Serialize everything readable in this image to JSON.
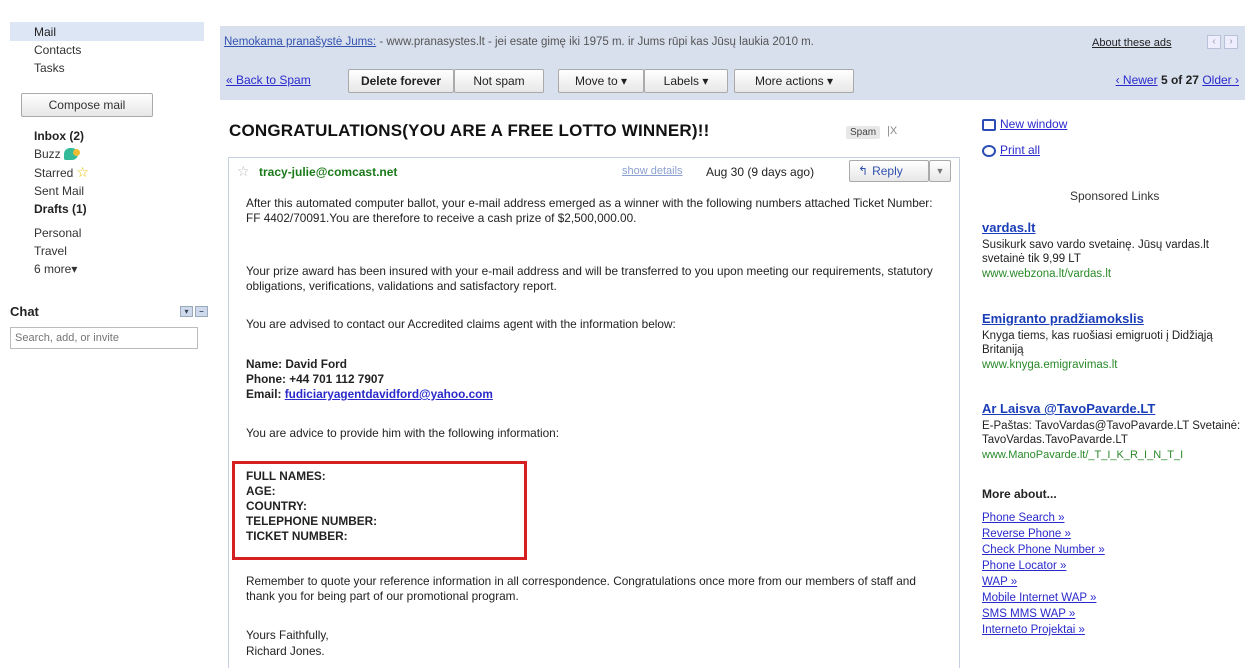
{
  "nav": {
    "mail": "Mail",
    "contacts": "Contacts",
    "tasks": "Tasks",
    "compose": "Compose mail",
    "inbox": "Inbox (2)",
    "buzz": "Buzz",
    "starred": "Starred",
    "sent": "Sent Mail",
    "drafts": "Drafts (1)",
    "personal": "Personal",
    "travel": "Travel",
    "more": "6 more▾"
  },
  "chat": {
    "title": "Chat",
    "search_placeholder": "Search, add, or invite"
  },
  "adbar": {
    "link": "Nemokama pranašystė Jums:",
    "text": " - www.pranasystes.lt - jei esate gimę iki 1975 m. ir Jums rūpi kas Jūsų laukia 2010 m.",
    "about": "About these ads"
  },
  "toolbar": {
    "back": "« Back to Spam",
    "delete_forever": "Delete forever",
    "not_spam": "Not spam",
    "move_to": "Move to ▾",
    "labels": "Labels ▾",
    "more_actions": "More actions ▾",
    "newer": "‹ Newer",
    "position": "5 of 27",
    "older": "Older ›"
  },
  "message": {
    "subject": "CONGRATULATIONS(YOU ARE A FREE LOTTO WINNER)!!",
    "spam_label": "Spam",
    "spam_close": "|X",
    "sender": "tracy-julie@comcast.net",
    "show_details": "show details",
    "date": "Aug 30 (9 days ago)",
    "reply": "Reply",
    "para1": "After this automated computer ballot, your e-mail address emerged as a winner with the following numbers attached Ticket Number: FF 4402/70091.You are therefore to receive a cash prize of $2,500,000.00.",
    "para2": "Your prize award has been insured with your e-mail address and will be transferred to you upon meeting our requirements, statutory obligations, verifications, validations and satisfactory report.",
    "para3": "You are advised to contact our Accredited claims agent with the information below:",
    "name_line": "Name:  David Ford",
    "phone_line": "Phone: +44 701 112 7907",
    "email_label": "Email: ",
    "email_link": "fudiciaryagentdavidford@yahoo.com",
    "para4": "You are advice to provide him with the following information:",
    "fields": [
      "FULL NAMES:",
      "AGE:",
      "COUNTRY:",
      "TELEPHONE NUMBER:",
      "TICKET NUMBER:"
    ],
    "para5": "Remember to quote your reference information in all correspondence. Congratulations once more from our members of staff and thank you for being part of our promotional program.",
    "closing": "Yours Faithfully,",
    "signature": "Richard Jones."
  },
  "right": {
    "new_window": "New window",
    "print_all": "Print all",
    "sponsored": "Sponsored Links",
    "ads": [
      {
        "title": "vardas.lt",
        "desc": "Susikurk savo vardo svetainę. Jūsų vardas.lt svetainė tik 9,99 LT",
        "url": "www.webzona.lt/vardas.lt"
      },
      {
        "title": "Emigranto pradžiamokslis",
        "desc": "Knyga tiems, kas ruošiasi emigruoti į Didžiąją Britaniją",
        "url": "www.knyga.emigravimas.lt"
      },
      {
        "title": "Ar Laisva @TavoPavarde.LT",
        "desc": "E-Paštas: TavoVardas@TavoPavarde.LT Svetainė: TavoVardas.TavoPavarde.LT",
        "url": "www.ManoPavarde.lt/_T_I_K_R_I_N_T_I"
      }
    ],
    "more_about": "More about...",
    "more_links": [
      "Phone Search »",
      "Reverse Phone »",
      "Check Phone Number »",
      "Phone Locator »",
      "WAP »",
      "Mobile Internet WAP »",
      "SMS MMS WAP »",
      "Interneto Projektai »"
    ]
  },
  "colors": {
    "nav_highlight": "#dde6f5",
    "toolbar_bg": "#d8e0ee",
    "sender": "#1a7a1a",
    "highlight_box": "#d42020",
    "link": "#2a2acc"
  }
}
